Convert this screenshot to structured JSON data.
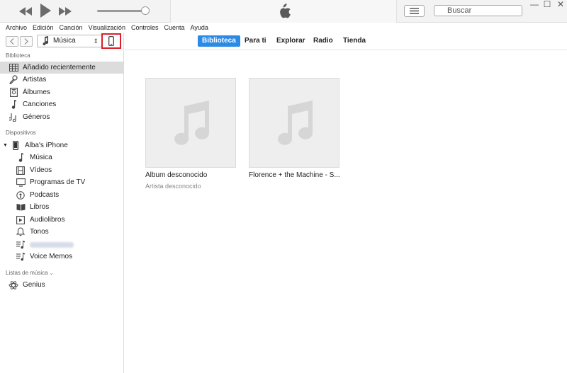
{
  "menu": [
    "Archivo",
    "Edición",
    "Canción",
    "Visualización",
    "Controles",
    "Cuenta",
    "Ayuda"
  ],
  "search": {
    "placeholder": "Buscar"
  },
  "media_selector": {
    "value": "Música"
  },
  "tabs": [
    "Biblioteca",
    "Para ti",
    "Explorar",
    "Radio",
    "Tienda"
  ],
  "sidebar": {
    "library_header": "Biblioteca",
    "library": [
      {
        "label": "Añadido recientemente",
        "icon": "grid-icon"
      },
      {
        "label": "Artistas",
        "icon": "microphone-icon"
      },
      {
        "label": "Álbumes",
        "icon": "album-icon"
      },
      {
        "label": "Canciones",
        "icon": "note-icon"
      },
      {
        "label": "Géneros",
        "icon": "genres-icon"
      }
    ],
    "devices_header": "Dispositivos",
    "device_name": "Alba's iPhone",
    "device_items": [
      {
        "label": "Música",
        "icon": "note-icon"
      },
      {
        "label": "Vídeos",
        "icon": "film-icon"
      },
      {
        "label": "Programas de TV",
        "icon": "tv-icon"
      },
      {
        "label": "Podcasts",
        "icon": "podcast-icon"
      },
      {
        "label": "Libros",
        "icon": "book-icon"
      },
      {
        "label": "Audiolibros",
        "icon": "audiobook-icon"
      },
      {
        "label": "Tonos",
        "icon": "bell-icon"
      },
      {
        "label": "",
        "icon": "playlist-icon"
      },
      {
        "label": "Voice Memos",
        "icon": "playlist-icon"
      }
    ],
    "playlists_header": "Listas de música",
    "playlists": [
      {
        "label": "Genius",
        "icon": "atom-icon"
      }
    ]
  },
  "albums": [
    {
      "title": "Álbum desconocido",
      "artist": "Artista desconocido"
    },
    {
      "title": "Florence + the Machine - S...",
      "artist": ""
    }
  ],
  "colors": {
    "accent": "#2a8ae5",
    "highlight": "#d9202a",
    "selected_row": "#dcdcdc"
  }
}
